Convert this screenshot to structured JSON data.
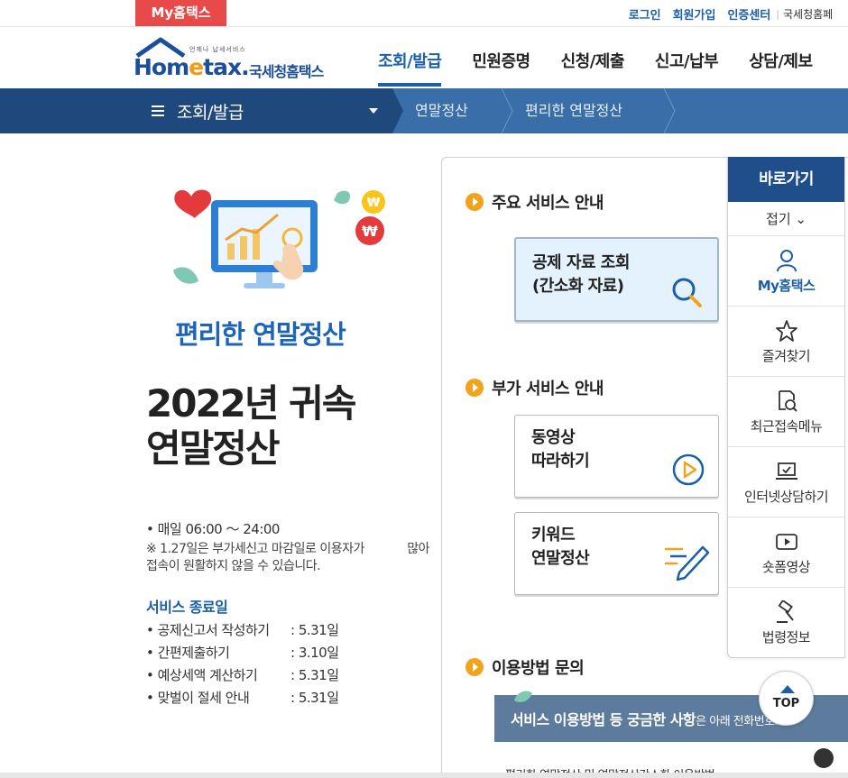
{
  "topbar": {
    "my_tab": "My홈택스",
    "links": [
      "로그인",
      "회원가입",
      "인증센터"
    ],
    "site_name": "국세청홈페"
  },
  "header": {
    "logo_small": "언제나 납세서비스",
    "logo_brand_a": "Hom",
    "logo_brand_e": "e",
    "logo_brand_b": "tax.",
    "logo_kr": "국세청홈택스",
    "gnb": [
      "조회/발급",
      "민원증명",
      "신청/제출",
      "신고/납부",
      "상담/제보"
    ]
  },
  "location": {
    "menu": "조회/발급",
    "crumbs": [
      "연말정산",
      "편리한 연말정산"
    ]
  },
  "promo": {
    "subtitle": "편리한 연말정산",
    "title_line1": "2022년 귀속",
    "title_line2": "연말정산",
    "hours": "• 매일 06:00 ～ 24:00",
    "note": "※ 1.27일은 부가세신고 마감일로 이용자가            많아 접속이 원활하지 않을 수 있습니다.",
    "end_title": "서비스 종료일",
    "end_items": [
      {
        "name": "• 공제신고서 작성하기",
        "date": ": 5.31일"
      },
      {
        "name": "• 간편제출하기",
        "date": ": 3.10일"
      },
      {
        "name": "• 예상세액 계산하기",
        "date": ": 5.31일"
      },
      {
        "name": "• 맞벌이 절세 안내",
        "date": ": 5.31일"
      }
    ]
  },
  "panel": {
    "main_title": "주요 서비스 안내",
    "main_card_line1": "공제 자료 조회",
    "main_card_line2": "(간소화 자료)",
    "extra_title": "부가 서비스 안내",
    "video_line1": "동영상",
    "video_line2": "따라하기",
    "keyword_line1": "키워드",
    "keyword_line2": "연말정산",
    "help_title": "이용방법 문의",
    "banner_bold": "서비스 이용방법 등 궁금한 사항",
    "banner_light": "은 아래 전화번호로",
    "bottom_text": "편리한 연말정산 및 연말정산간소화 이용방법"
  },
  "quick": {
    "title": "바로가기",
    "fold": "접기 ⌄",
    "items": [
      "My홈택스",
      "즐겨찾기",
      "최근접속메뉴",
      "인터넷상담하기",
      "숏폼영상",
      "법령정보"
    ]
  },
  "top_button": "TOP",
  "colors": {
    "brand_blue": "#1c5fa9",
    "nav_dark": "#1f497c",
    "nav_light": "#3a6ea8",
    "accent_red": "#e84a4a",
    "bullet_orange": "#f3a21b"
  }
}
